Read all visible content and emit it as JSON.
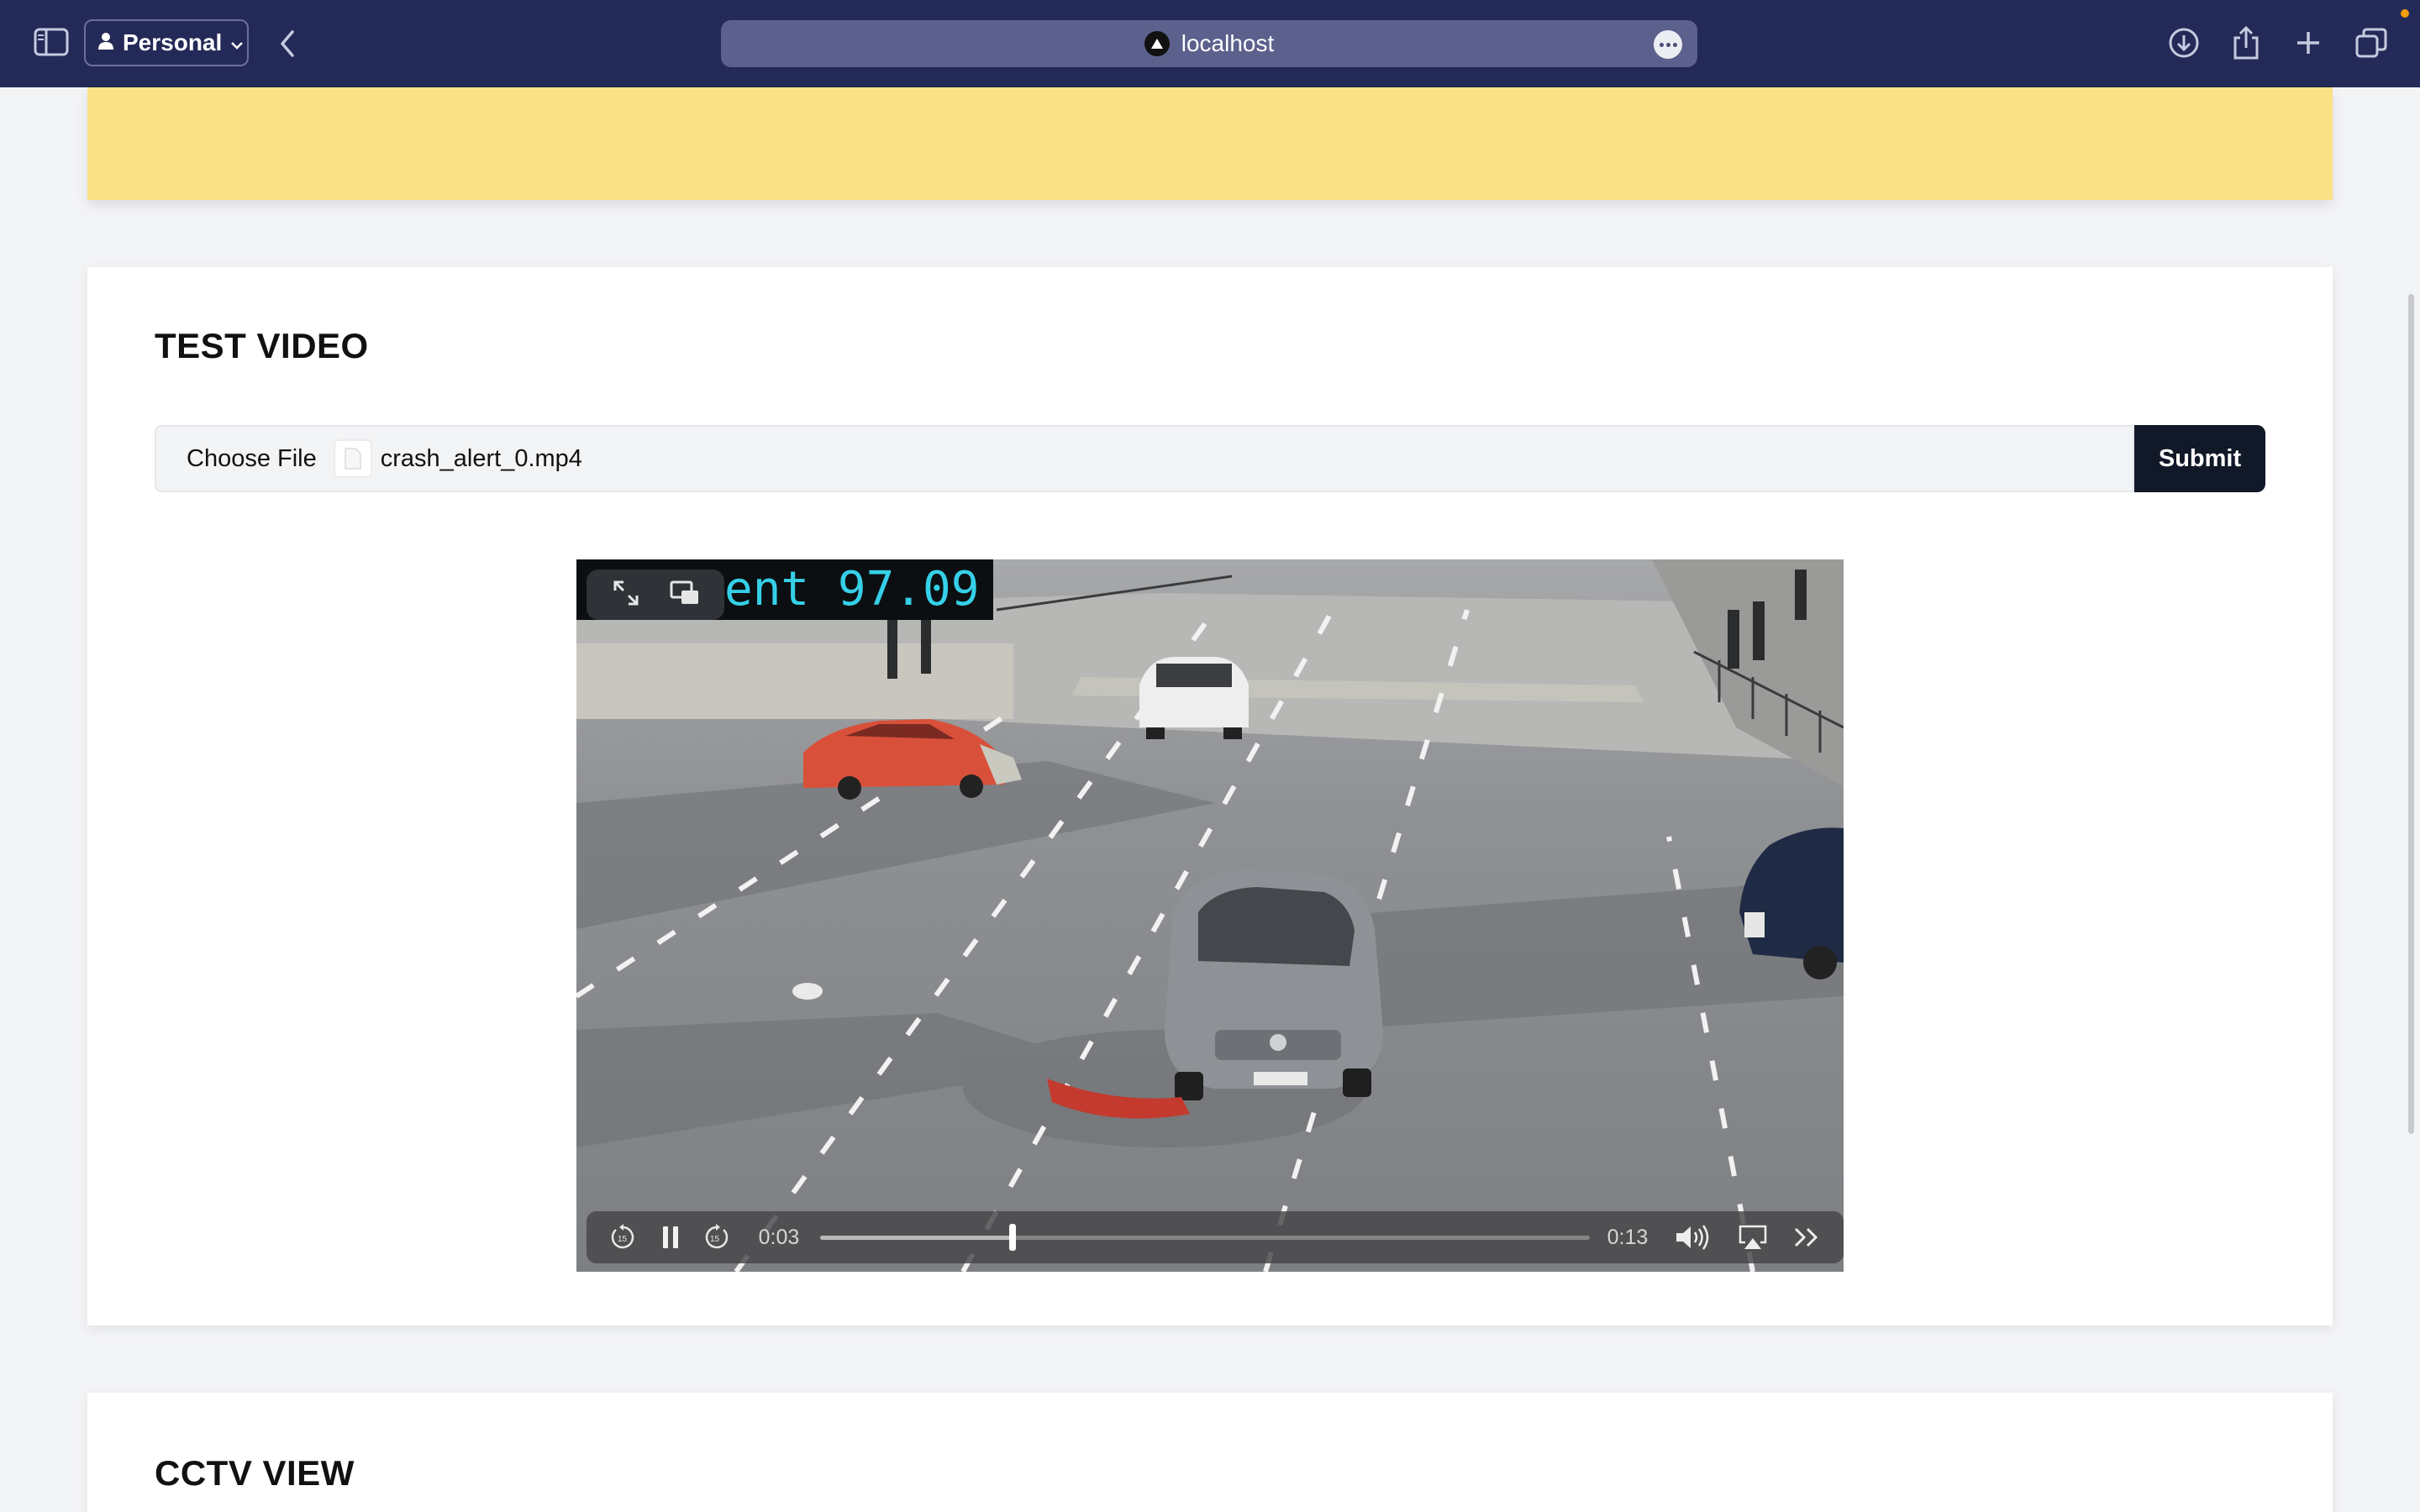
{
  "browser": {
    "profile_label": "Personal",
    "url": "localhost"
  },
  "page": {
    "test_video": {
      "title": "TEST VIDEO",
      "file_input": {
        "choose_label": "Choose File",
        "file_name": "crash_alert_0.mp4"
      },
      "submit_label": "Submit",
      "video": {
        "overlay_text": "ent 97.09",
        "current_time": "0:03",
        "duration": "0:13",
        "progress": 0.25
      }
    },
    "cctv": {
      "title": "CCTV VIEW"
    }
  },
  "colors": {
    "toolbar": "#232a57",
    "banner": "#fae186",
    "submit": "#111827",
    "overlay_text": "#35d0e8"
  },
  "icons": [
    "sidebar-icon",
    "person-icon",
    "chevron-down-icon",
    "back-icon",
    "site-icon",
    "more-icon",
    "download-icon",
    "share-icon",
    "plus-icon",
    "tabs-icon",
    "expand-icon",
    "picture-in-picture-icon",
    "skip-back-15-icon",
    "pause-icon",
    "skip-forward-15-icon",
    "volume-icon",
    "airplay-icon",
    "fast-forward-icon",
    "file-icon"
  ]
}
